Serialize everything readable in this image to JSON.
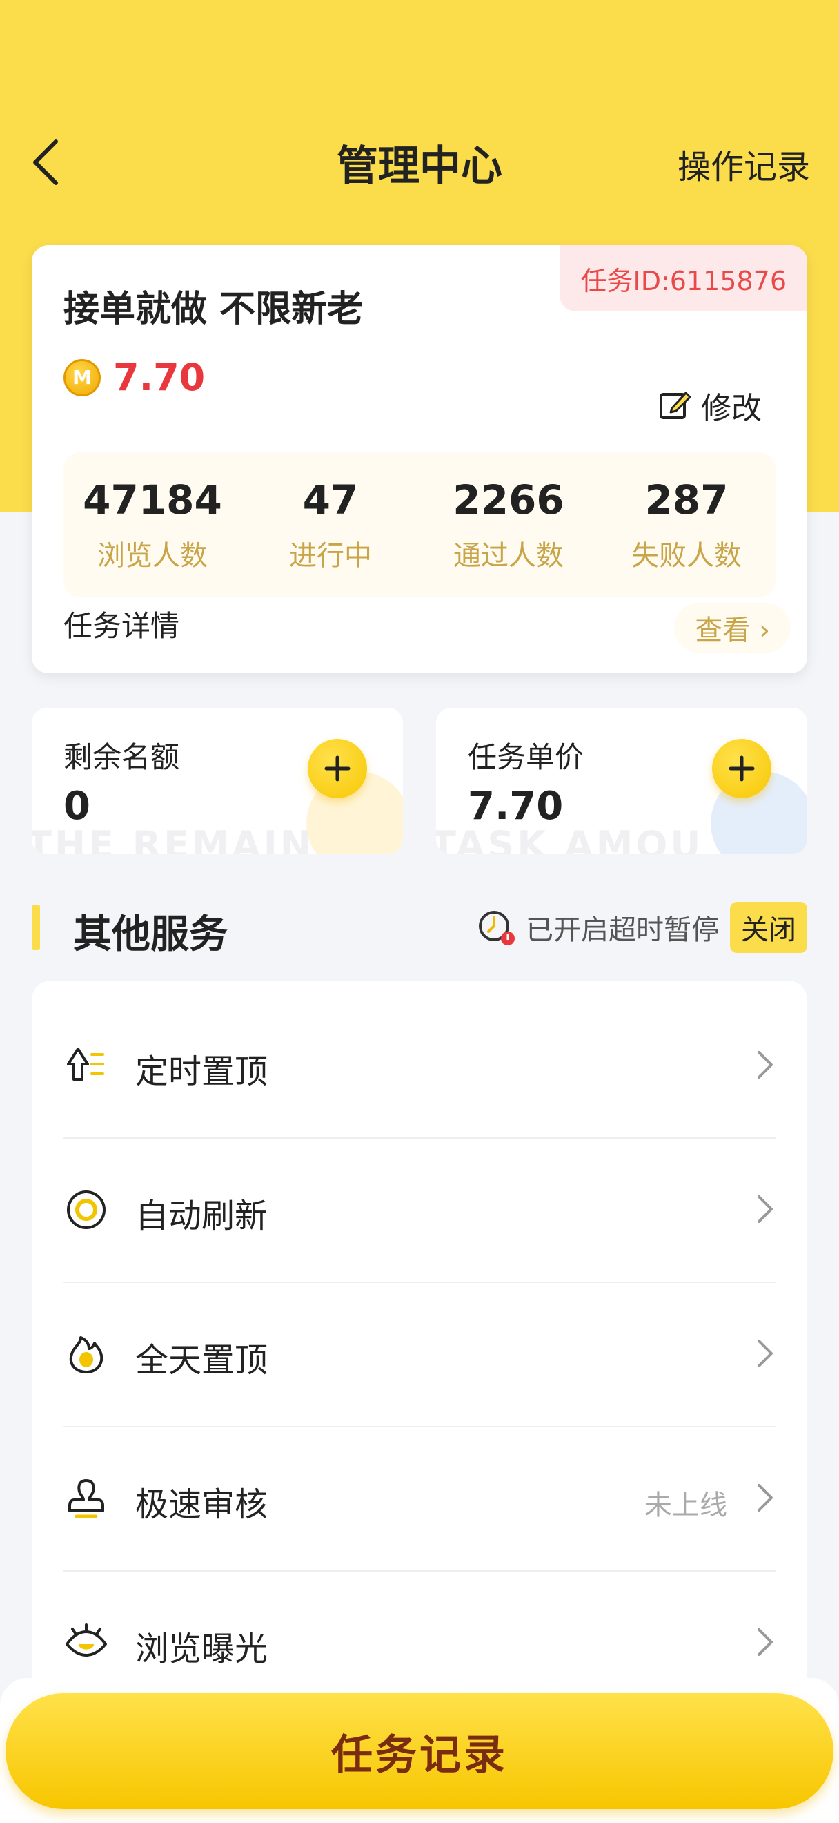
{
  "header": {
    "title": "管理中心",
    "op_record": "操作记录"
  },
  "task": {
    "id_label": "任务ID:6115876",
    "title": "接单就做 不限新老",
    "coin_symbol": "M",
    "price": "7.70",
    "edit_label": "修改",
    "stats": [
      {
        "value": "47184",
        "label": "浏览人数"
      },
      {
        "value": "47",
        "label": "进行中"
      },
      {
        "value": "2266",
        "label": "通过人数"
      },
      {
        "value": "287",
        "label": "失败人数"
      }
    ],
    "detail_label": "任务详情",
    "view_label": "查看 ›"
  },
  "quota": {
    "label": "剩余名额",
    "value": "0",
    "watermark": "THE REMAIN"
  },
  "unit_price": {
    "label": "任务单价",
    "value": "7.70",
    "watermark": "TASK AMOU"
  },
  "services": {
    "title": "其他服务",
    "timeout_text": "已开启超时暂停",
    "close_label": "关闭",
    "items": [
      {
        "label": "定时置顶",
        "status": "",
        "icon": "timed-top-icon"
      },
      {
        "label": "自动刷新",
        "status": "",
        "icon": "refresh-icon"
      },
      {
        "label": "全天置顶",
        "status": "",
        "icon": "flame-icon"
      },
      {
        "label": "极速审核",
        "status": "未上线",
        "icon": "review-icon"
      },
      {
        "label": "浏览曝光",
        "status": "",
        "icon": "eye-icon"
      }
    ]
  },
  "bottom": {
    "button_label": "任务记录"
  },
  "colors": {
    "brand_yellow": "#fbdc4b",
    "price_red": "#e8383d",
    "stat_label": "#c9a54a"
  }
}
